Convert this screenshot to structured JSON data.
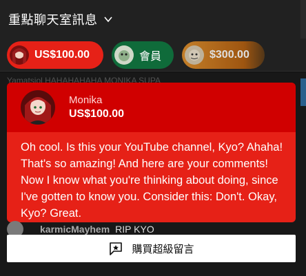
{
  "header": {
    "title": "重點聊天室訊息"
  },
  "ticker": [
    {
      "label": "US$100.00",
      "color": "#e62117"
    },
    {
      "label": "會員",
      "color": "#0f6b3a"
    },
    {
      "label": "$300.00",
      "color": "#e08f2a"
    }
  ],
  "background_chat": {
    "ghost": "Yamatsiol HAHAHAHAHA MONIKA SUPA"
  },
  "superchat": {
    "author": "Monika",
    "amount": "US$100.00",
    "message": "Oh cool. Is this your YouTube channel, Kyo? Ahaha! That's so amazing! And here are your comments! Now I know what you're thinking about doing, since I've gotten to know you. Consider this: Don't. Okay, Kyo? Great.",
    "color_header": "#d00000",
    "color_body": "#e62117"
  },
  "chat_message": {
    "author": "karmicMayhem",
    "text": "RIP KYO"
  },
  "buy_button": {
    "label": "購買超級留言"
  }
}
